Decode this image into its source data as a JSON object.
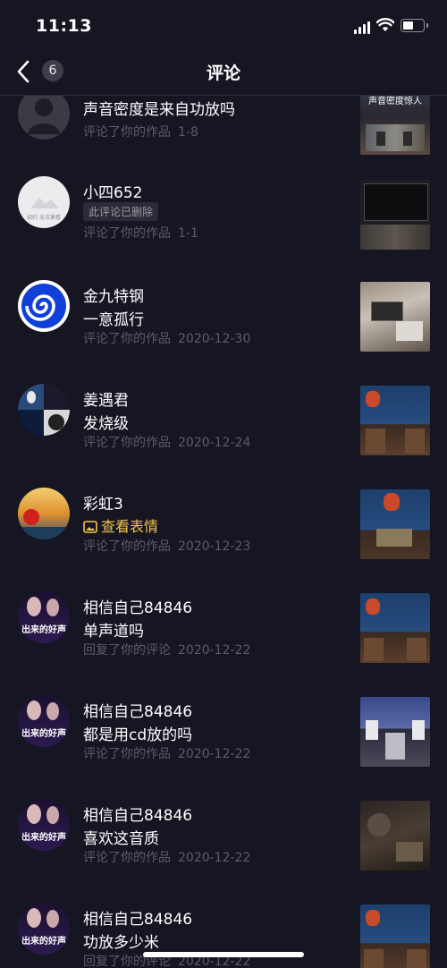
{
  "status_bar": {
    "time": "11:13"
  },
  "nav": {
    "title": "评论",
    "back_count": "6"
  },
  "comments": [
    {
      "nickname": "",
      "content": "声音密度是来自功放吗",
      "action": "评论了你的作品",
      "date": "1-8",
      "thumb_text": "声音密度惊人",
      "avatar_icon": "default-user-icon"
    },
    {
      "nickname": "小四652",
      "content": "",
      "deleted_label": "此评论已删除",
      "action": "评论了你的作品",
      "date": "1-1",
      "avatar_text": "如约 无法莫看"
    },
    {
      "nickname": "金九特钢",
      "content": "一意孤行",
      "action": "评论了你的作品",
      "date": "2020-12-30"
    },
    {
      "nickname": "姜遇君",
      "content": "发烧级",
      "action": "评论了你的作品",
      "date": "2020-12-24"
    },
    {
      "nickname": "彩虹3",
      "content": "",
      "emoji_label": "查看表情",
      "action": "评论了你的作品",
      "date": "2020-12-23"
    },
    {
      "nickname": "相信自己84846",
      "content": "单声道吗",
      "action": "回复了你的评论",
      "date": "2020-12-22",
      "avatar_text": "出来的好声"
    },
    {
      "nickname": "相信自己84846",
      "content": "都是用cd放的吗",
      "action": "评论了你的作品",
      "date": "2020-12-22",
      "avatar_text": "出来的好声"
    },
    {
      "nickname": "相信自己84846",
      "content": "喜欢这音质",
      "action": "评论了你的作品",
      "date": "2020-12-22",
      "avatar_text": "出来的好声"
    },
    {
      "nickname": "相信自己84846",
      "content": "功放多少米",
      "action": "回复了你的评论",
      "date": "2020-12-22",
      "avatar_text": "出来的好声"
    }
  ],
  "colors": {
    "background": "#161623",
    "accent_yellow": "#f2c54b",
    "meta_gray": "#5c5c69"
  }
}
